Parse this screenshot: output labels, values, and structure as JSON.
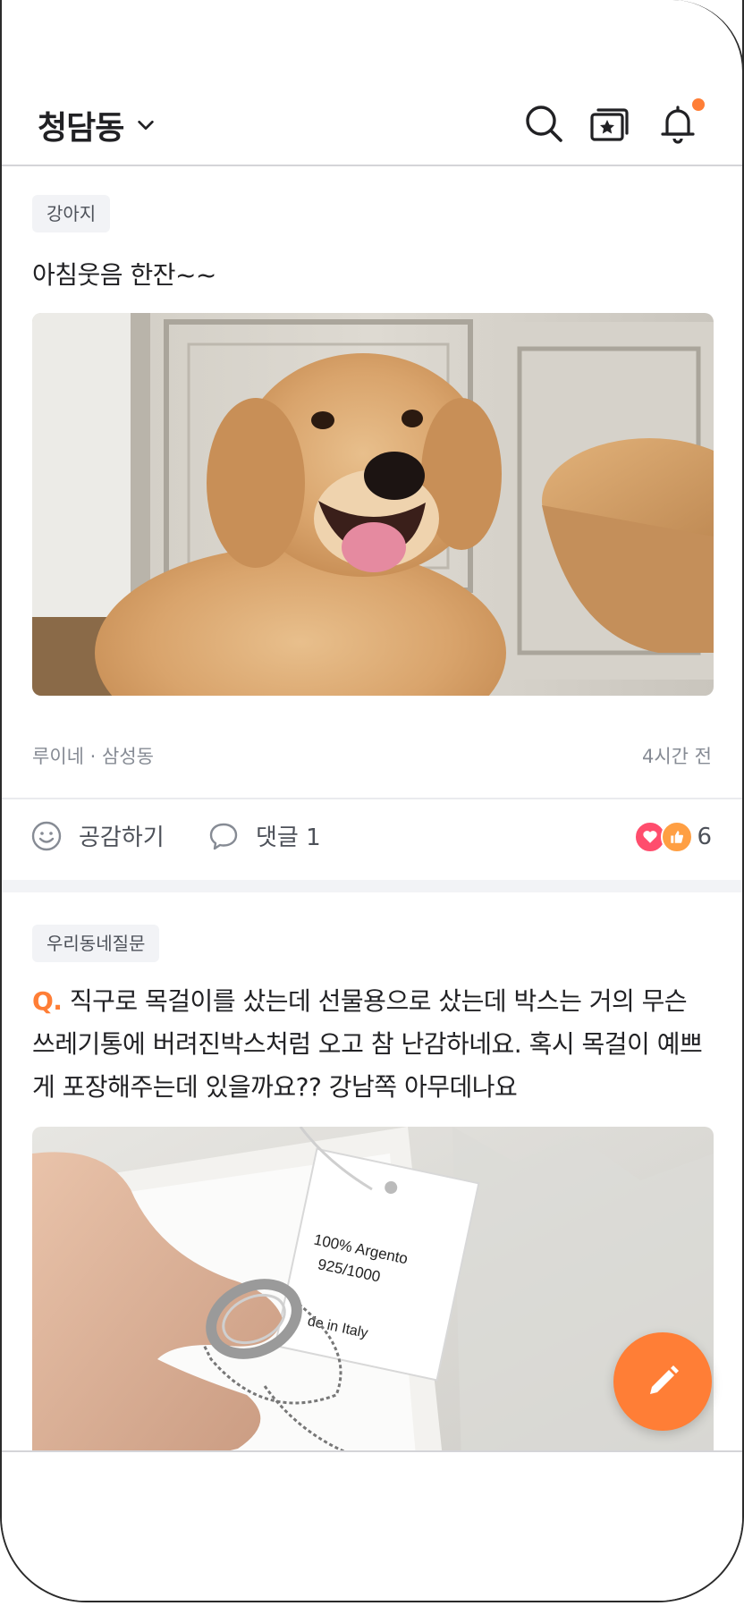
{
  "header": {
    "location": "청담동"
  },
  "posts": [
    {
      "tag": "강아지",
      "title": "아침웃음 한잔~~",
      "author": "루이네",
      "neighborhood": "삼성동",
      "time": "4시간 전",
      "like_label": "공감하기",
      "comment_label": "댓글 1",
      "reaction_count": "6"
    },
    {
      "tag": "우리동네질문",
      "q_prefix": "Q.",
      "title": "직구로 목걸이를 샀는데 선물용으로 샀는데 박스는 거의 무슨 쓰레기통에 버려진박스처럼 오고 참 난감하네요. 혹시 목걸이 예쁘게 포장해주는데 있을까요?? 강남쪽 아무데나요",
      "photo_text": {
        "line1": "100% Argento",
        "line2": "925/1000",
        "line3": "de in Italy"
      }
    }
  ],
  "colors": {
    "accent": "#ff7e36",
    "heart": "#ff4d6d",
    "tag_bg": "#f2f3f6"
  }
}
